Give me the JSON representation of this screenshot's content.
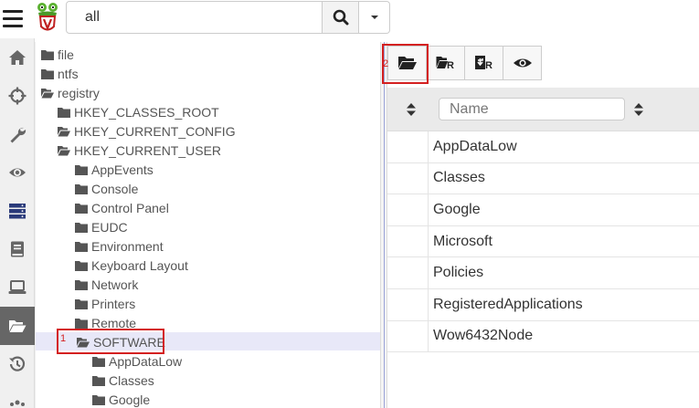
{
  "search": {
    "value": "all"
  },
  "sidebar": {
    "items": [
      {
        "name": "home-icon"
      },
      {
        "name": "crosshairs-icon"
      },
      {
        "name": "wrench-icon"
      },
      {
        "name": "eye-icon"
      },
      {
        "name": "server-icon"
      },
      {
        "name": "book-icon"
      },
      {
        "name": "laptop-icon"
      },
      {
        "name": "folder-open-icon",
        "active": true
      },
      {
        "name": "history-icon"
      }
    ]
  },
  "tree": {
    "nodes": [
      {
        "label": "file",
        "level": 0,
        "open": false
      },
      {
        "label": "ntfs",
        "level": 0,
        "open": false
      },
      {
        "label": "registry",
        "level": 0,
        "open": true
      },
      {
        "label": "HKEY_CLASSES_ROOT",
        "level": 1,
        "open": false
      },
      {
        "label": "HKEY_CURRENT_CONFIG",
        "level": 1,
        "open": true
      },
      {
        "label": "HKEY_CURRENT_USER",
        "level": 1,
        "open": true
      },
      {
        "label": "AppEvents",
        "level": 2,
        "open": false
      },
      {
        "label": "Console",
        "level": 2,
        "open": false
      },
      {
        "label": "Control Panel",
        "level": 2,
        "open": false
      },
      {
        "label": "EUDC",
        "level": 2,
        "open": false
      },
      {
        "label": "Environment",
        "level": 2,
        "open": false
      },
      {
        "label": "Keyboard Layout",
        "level": 2,
        "open": false
      },
      {
        "label": "Network",
        "level": 2,
        "open": false
      },
      {
        "label": "Printers",
        "level": 2,
        "open": false
      },
      {
        "label": "Remote",
        "level": 2,
        "open": false
      },
      {
        "label": "SOFTWARE",
        "level": 2,
        "open": true,
        "selected": true
      },
      {
        "label": "AppDataLow",
        "level": 3,
        "open": false
      },
      {
        "label": "Classes",
        "level": 3,
        "open": false
      },
      {
        "label": "Google",
        "level": 3,
        "open": false
      }
    ]
  },
  "toolbar": {
    "buttons": [
      {
        "name": "open-folder-button"
      },
      {
        "name": "folder-refresh-button"
      },
      {
        "name": "download-refresh-button"
      },
      {
        "name": "view-button"
      }
    ]
  },
  "table": {
    "filter_placeholder": "Name",
    "rows": [
      "AppDataLow",
      "Classes",
      "Google",
      "Microsoft",
      "Policies",
      "RegisteredApplications",
      "Wow6432Node"
    ]
  },
  "annotations": [
    {
      "number": "1"
    },
    {
      "number": "2"
    }
  ],
  "colors": {
    "accent_active": "#666666",
    "server_icon": "#2a3a7a",
    "annotation": "#d42020",
    "selection": "#e8e8f8"
  }
}
